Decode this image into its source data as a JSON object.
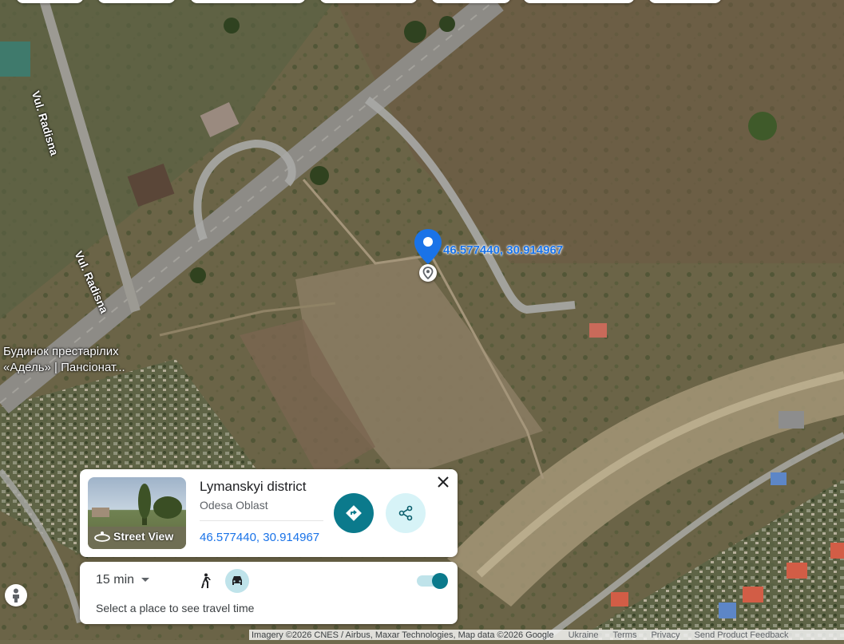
{
  "map": {
    "road_labels": [
      "Vul. Radisna",
      "Vul. Radisna"
    ],
    "place_label": "Будинок престарілих «Адель» | Пансіонат...",
    "pin_coords": "46.577440, 30.914967",
    "watermark": "2026 Google"
  },
  "place_card": {
    "title": "Lymanskyi district",
    "subtitle": "Odesa Oblast",
    "coords": "46.577440, 30.914967",
    "street_view_label": "Street View",
    "directions_icon": "directions-icon",
    "share_icon": "share-icon",
    "close_icon": "close-icon"
  },
  "travel_card": {
    "time_option": "15 min",
    "hint": "Select a place to see travel time",
    "walk_icon": "walk-icon",
    "car_icon": "car-icon",
    "toggle_on": true
  },
  "footer": {
    "attribution": "Imagery ©2026 CNES / Airbus, Maxar Technologies, Map data ©2026 Google",
    "links": [
      "Ukraine",
      "Terms",
      "Privacy",
      "Send Product Feedback"
    ]
  },
  "colors": {
    "accent": "#0b7a8c",
    "accent_light": "#d7f3f7",
    "coords": "#1a73e8"
  }
}
